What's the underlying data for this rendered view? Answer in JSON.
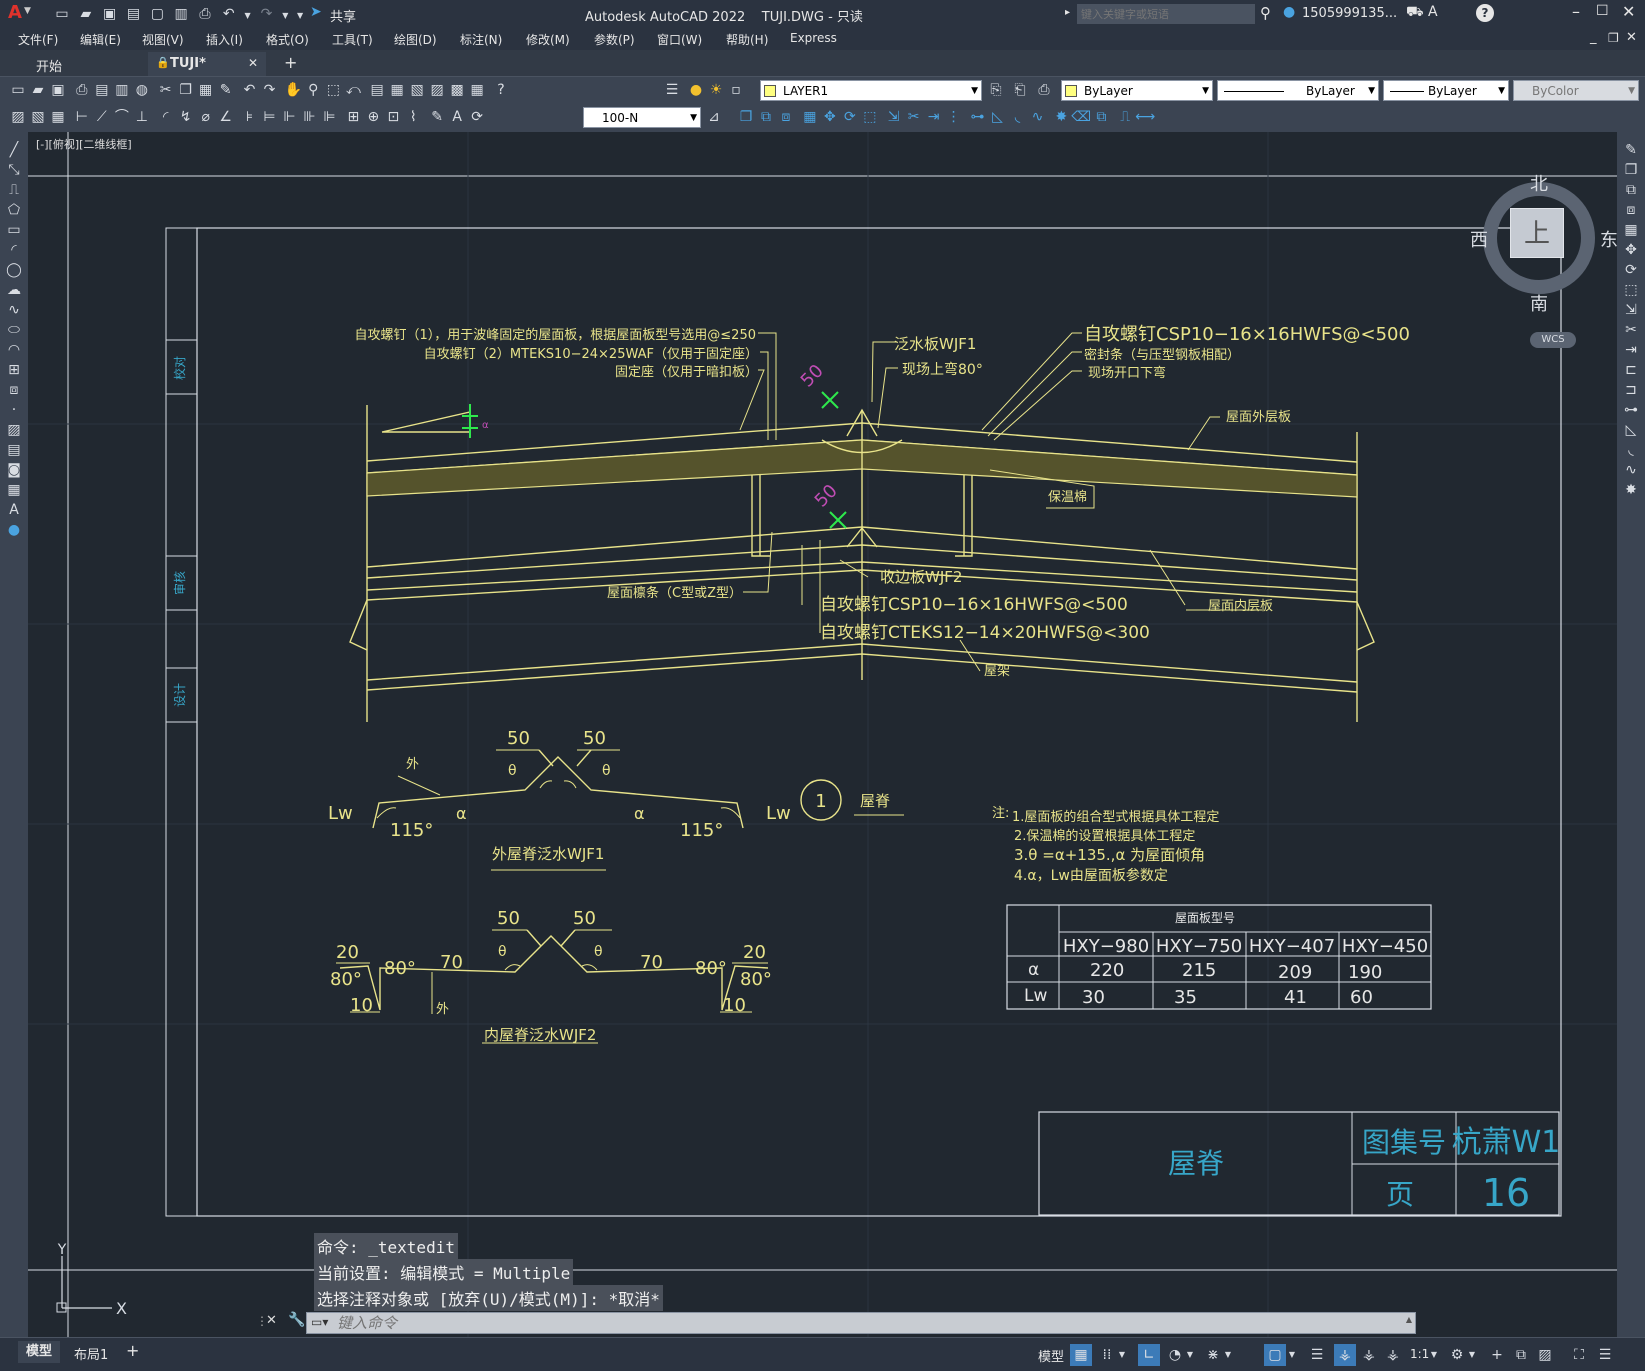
{
  "titlebar": {
    "app_letter": "A",
    "share_label": "共享",
    "title": "Autodesk AutoCAD 2022    TUJI.DWG - 只读",
    "search_placeholder": "键入关键字或短语",
    "user": "1505999135...",
    "help": "?"
  },
  "menu": [
    "文件(F)",
    "编辑(E)",
    "视图(V)",
    "插入(I)",
    "格式(O)",
    "工具(T)",
    "绘图(D)",
    "标注(N)",
    "修改(M)",
    "参数(P)",
    "窗口(W)",
    "帮助(H)",
    "Express"
  ],
  "tabs": {
    "start": "开始",
    "active": "TUJI*",
    "add": "+"
  },
  "ribbon": {
    "layer": "LAYER1",
    "color": "ByLayer",
    "linetype": "ByLayer",
    "lineweight": "ByLayer",
    "plotstyle": "ByColor",
    "dimstyle": "100-N"
  },
  "viewport_label": "[-][俯视][二维线框]",
  "viewcube": {
    "north": "北",
    "south": "南",
    "east": "东",
    "west": "西",
    "top": "上",
    "wcs": "WCS"
  },
  "drawing": {
    "side_labels": [
      "校对",
      "审核",
      "设计"
    ],
    "top_labels": [
      "自攻螺钉（1），用于波峰固定的屋面板，根据屋面板型号选用@≤250",
      "自攻螺钉（2）MTEKS10−24×25WAF（仅用于固定座）",
      "固定座（仅用于暗扣板）"
    ],
    "wjf1_label": "泛水板WJF1",
    "bend_label": "现场上弯80°",
    "right_labels": [
      "自攻螺钉CSP10−16×16HWFS@<500",
      "密封条（与压型钢板相配）",
      "现场开口下弯"
    ],
    "outer_panel": "屋面外层板",
    "insulation": "保温棉",
    "bottom_labels": [
      "收边板WJF2",
      "自攻螺钉CSP10−16×16HWFS@<500",
      "自攻螺钉CTEKS12−14×20HWFS@<300"
    ],
    "purlin": "屋面檩条（C型或Z型）",
    "inner_panel": "屋面内层板",
    "truss": "屋架",
    "dim50": "50",
    "detail_num": "1",
    "detail_title": "屋脊",
    "wjf1": {
      "fifty": "50",
      "theta": "θ",
      "outer": "外",
      "lw": "Lw",
      "a": "α",
      "angle": "115°",
      "caption": "外屋脊泛水WJF1"
    },
    "wjf2": {
      "fifty": "50",
      "theta": "θ",
      "seventy": "70",
      "eighty": "80°",
      "twenty": "20",
      "ten": "10",
      "outer": "外",
      "caption": "内屋脊泛水WJF2"
    },
    "notes_title": "注:",
    "notes": [
      "1.屋面板的组合型式根据具体工程定",
      "2.保温棉的设置根据具体工程定",
      "3.θ =α+135.,α 为屋面倾角",
      "4.α，Lw由屋面板参数定"
    ],
    "table": {
      "title": "屋面板型号",
      "headers": [
        "HXY−980",
        "HXY−750",
        "HXY−407",
        "HXY−450"
      ],
      "rows": [
        {
          "label": "α",
          "values": [
            "220",
            "215",
            "209",
            "190"
          ]
        },
        {
          "label": "Lw",
          "values": [
            "30",
            "35",
            "41",
            "60"
          ]
        }
      ]
    },
    "titleblock": {
      "name": "屋脊",
      "atlas_label": "图集号",
      "atlas_value": "杭萧W1",
      "page_label": "页",
      "page_value": "16"
    }
  },
  "ucs": {
    "x": "X",
    "y": "Y"
  },
  "command": {
    "history": [
      "命令: _textedit",
      "当前设置: 编辑模式 = Multiple",
      "选择注释对象或 [放弃(U)/模式(M)]: *取消*"
    ],
    "placeholder": "键入命令"
  },
  "status": {
    "model_tab": "模型",
    "layout_tab": "布局1",
    "add": "+",
    "model_btn": "模型",
    "scale": "1:1"
  }
}
